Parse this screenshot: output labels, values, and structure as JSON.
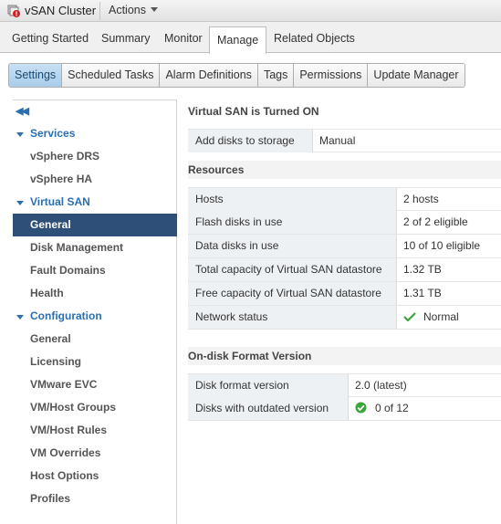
{
  "titlebar": {
    "title": "vSAN Cluster",
    "actions_label": "Actions"
  },
  "top_tabs": [
    "Getting Started",
    "Summary",
    "Monitor",
    "Manage",
    "Related Objects"
  ],
  "sub_tabs": [
    "Settings",
    "Scheduled Tasks",
    "Alarm Definitions",
    "Tags",
    "Permissions",
    "Update Manager"
  ],
  "nav": {
    "services": "Services",
    "drs": "vSphere DRS",
    "ha": "vSphere HA",
    "vsan": "Virtual SAN",
    "general": "General",
    "disk_mgmt": "Disk Management",
    "fault_domains": "Fault Domains",
    "health": "Health",
    "configuration": "Configuration",
    "cfg_general": "General",
    "licensing": "Licensing",
    "evc": "VMware EVC",
    "vmhost_groups": "VM/Host Groups",
    "vmhost_rules": "VM/Host Rules",
    "vm_overrides": "VM Overrides",
    "host_options": "Host Options",
    "profiles": "Profiles"
  },
  "status_section": {
    "title": "Virtual SAN is Turned ON",
    "rows": [
      {
        "key": "Add disks to storage",
        "value": "Manual"
      }
    ]
  },
  "resources": {
    "title": "Resources",
    "rows": [
      {
        "key": "Hosts",
        "value": "2 hosts"
      },
      {
        "key": "Flash disks in use",
        "value": "2 of 2 eligible"
      },
      {
        "key": "Data disks in use",
        "value": "10 of 10 eligible"
      },
      {
        "key": "Total capacity of Virtual SAN datastore",
        "value": "1.32 TB"
      },
      {
        "key": "Free capacity of Virtual SAN datastore",
        "value": "1.31 TB"
      },
      {
        "key": "Network status",
        "value": "Normal",
        "icon": "check-icon"
      }
    ]
  },
  "format_section": {
    "title": "On-disk Format Version",
    "rows": [
      {
        "key": "Disk format version",
        "value": "2.0 (latest)"
      },
      {
        "key": "Disks with outdated version",
        "value": "0 of 12",
        "icon": "ok-circle-icon"
      }
    ]
  },
  "colors": {
    "selection": "#2d4f78",
    "link_blue": "#2a6fb0",
    "active_subtab": "#b8d6ef",
    "ok_green": "#3aa63a"
  }
}
